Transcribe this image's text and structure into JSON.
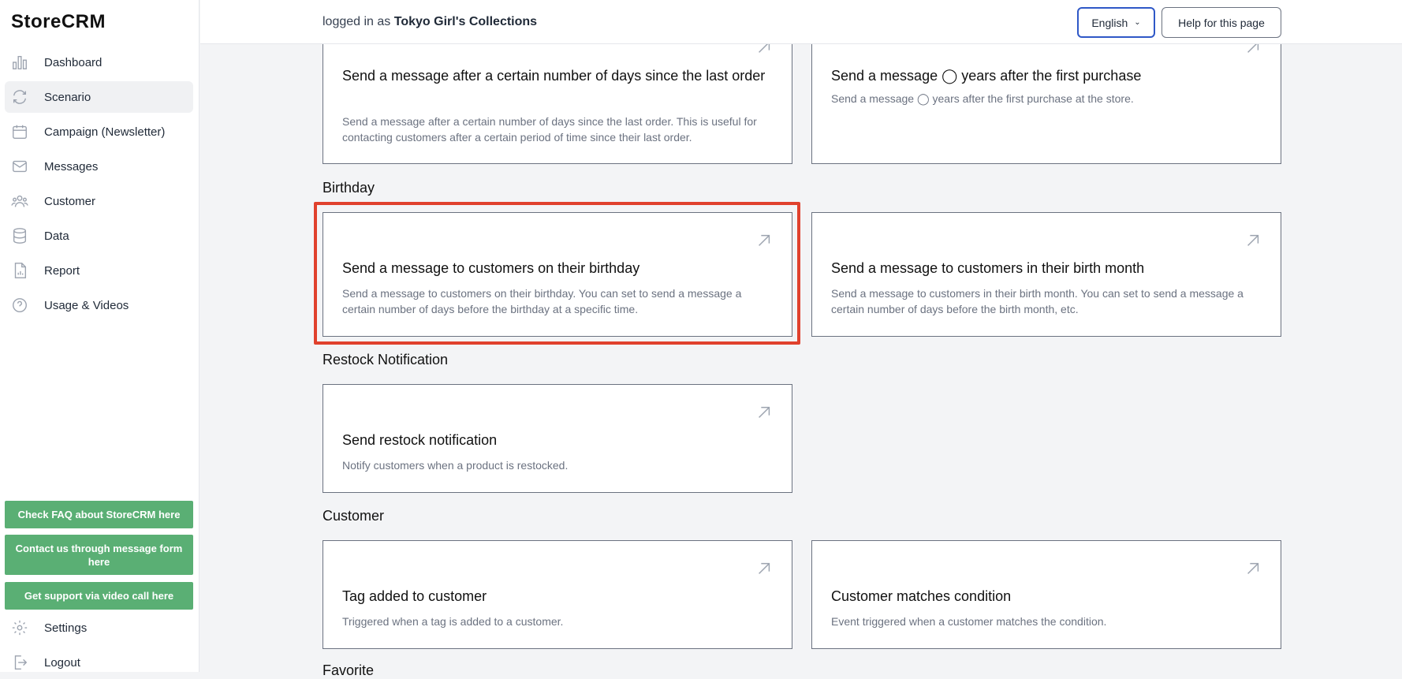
{
  "app": {
    "logo": "StoreCRM"
  },
  "sidebar": {
    "items": [
      {
        "label": "Dashboard",
        "icon": "bar-chart-icon"
      },
      {
        "label": "Scenario",
        "icon": "refresh-icon",
        "active": true
      },
      {
        "label": "Campaign (Newsletter)",
        "icon": "calendar-icon"
      },
      {
        "label": "Messages",
        "icon": "envelope-icon"
      },
      {
        "label": "Customer",
        "icon": "users-icon"
      },
      {
        "label": "Data",
        "icon": "database-icon"
      },
      {
        "label": "Report",
        "icon": "document-chart-icon"
      },
      {
        "label": "Usage & Videos",
        "icon": "question-circle-icon"
      }
    ],
    "support_buttons": [
      "Check FAQ about StoreCRM here",
      "Contact us through message form here",
      "Get support via video call here"
    ],
    "settings_label": "Settings",
    "logout_label": "Logout",
    "support_color": "#5aaf74"
  },
  "header": {
    "logged_prefix": "logged in as",
    "store_name": "Tokyo Girl's Collections",
    "language": "English",
    "help": "Help for this page"
  },
  "sections": {
    "birthday": "Birthday",
    "restock": "Restock Notification",
    "customer": "Customer",
    "favorite": "Favorite"
  },
  "cards": {
    "last_order": {
      "title": "Send a message after a certain number of days since the last order",
      "desc": "Send a message after a certain number of days since the last order. This is useful for contacting customers after a certain period of time since their last order."
    },
    "first_purchase": {
      "title": "Send a message ◯ years after the first purchase",
      "desc": "Send a message ◯ years after the first purchase at the store."
    },
    "birthday": {
      "title": "Send a message to customers on their birthday",
      "desc": "Send a message to customers on their birthday. You can set to send a message a certain number of days before the birthday at a specific time."
    },
    "birth_month": {
      "title": "Send a message to customers in their birth month",
      "desc": "Send a message to customers in their birth month. You can set to send a message a certain number of days before the birth month, etc."
    },
    "restock": {
      "title": "Send restock notification",
      "desc": "Notify customers when a product is restocked."
    },
    "tag_added": {
      "title": "Tag added to customer",
      "desc": "Triggered when a tag is added to a customer."
    },
    "matches_condition": {
      "title": "Customer matches condition",
      "desc": "Event triggered when a customer matches the condition."
    }
  },
  "highlight_color": "#e0412d"
}
